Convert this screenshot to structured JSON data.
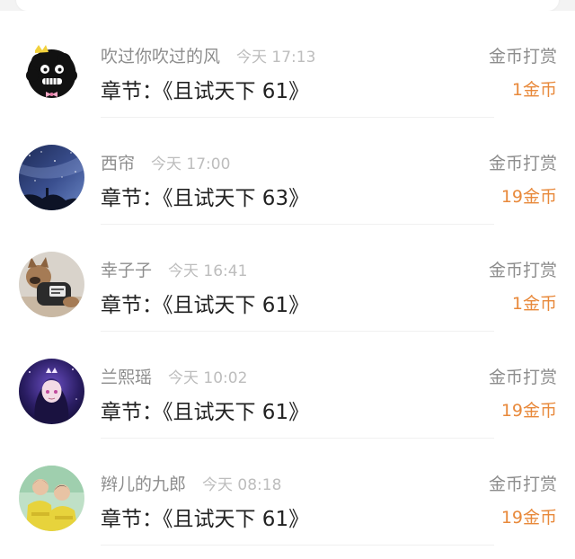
{
  "items": [
    {
      "user": "吹过你吹过的风",
      "time": "今天 17:13",
      "chapter": "章节：《且试天下 61》",
      "reward_label": "金币打赏",
      "reward_amount": "1金币",
      "avatar_icon": "black-fuzzy-monster-avatar"
    },
    {
      "user": "西帘",
      "time": "今天 17:00",
      "chapter": "章节：《且试天下 63》",
      "reward_label": "金币打赏",
      "reward_amount": "19金币",
      "avatar_icon": "starry-night-sky-avatar"
    },
    {
      "user": "幸子子",
      "time": "今天 16:41",
      "chapter": "章节：《且试天下 61》",
      "reward_label": "金币打赏",
      "reward_amount": "1金币",
      "avatar_icon": "dog-in-shirt-avatar"
    },
    {
      "user": "兰熙瑶",
      "time": "今天 10:02",
      "chapter": "章节：《且试天下 61》",
      "reward_label": "金币打赏",
      "reward_amount": "19金币",
      "avatar_icon": "anime-girl-avatar"
    },
    {
      "user": "辫儿的九郎",
      "time": "今天 08:18",
      "chapter": "章节：《且试天下 61》",
      "reward_label": "金币打赏",
      "reward_amount": "19金币",
      "avatar_icon": "two-performers-avatar"
    }
  ],
  "colors": {
    "accent": "#e8893b",
    "muted": "#8d8d8d",
    "time": "#bdbdbd",
    "title": "#222222"
  }
}
